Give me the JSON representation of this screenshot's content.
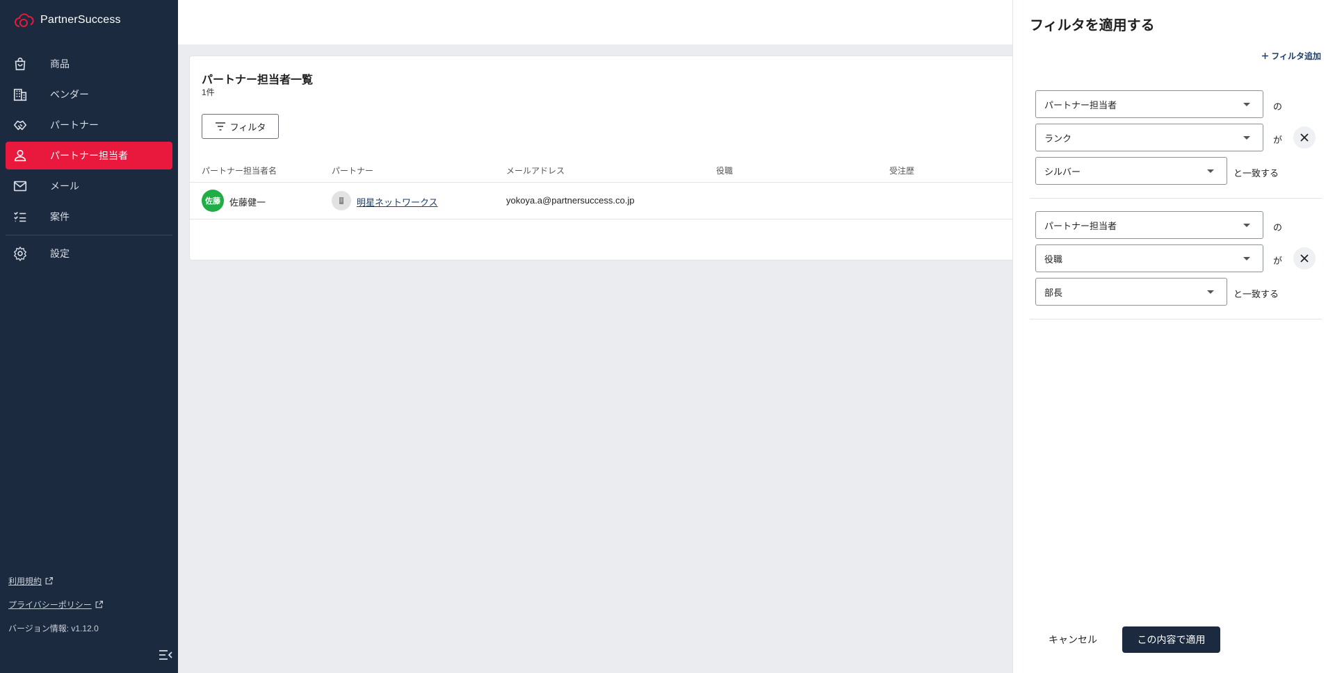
{
  "app": {
    "brand_name": "PartnerSuccess",
    "brand_color": "#e8193c",
    "sidebar_color": "#1b2a3f"
  },
  "sidebar": {
    "items": [
      {
        "label": "商品",
        "icon": "shopping-bag-icon"
      },
      {
        "label": "ベンダー",
        "icon": "building-icon"
      },
      {
        "label": "パートナー",
        "icon": "handshake-icon"
      },
      {
        "label": "パートナー担当者",
        "icon": "person-icon",
        "active": true
      },
      {
        "label": "メール",
        "icon": "mail-icon"
      },
      {
        "label": "案件",
        "icon": "checklist-icon"
      },
      {
        "label": "設定",
        "icon": "gear-icon"
      }
    ],
    "footer": {
      "terms": "利用規約",
      "privacy": "プライバシーポリシー",
      "version": "バージョン情報: v1.12.0"
    }
  },
  "list": {
    "title": "パートナー担当者一覧",
    "count": "1件",
    "filter_button": "フィルタ",
    "columns": [
      "パートナー担当者名",
      "パートナー",
      "メールアドレス",
      "役職",
      "受注歴"
    ],
    "rows": [
      {
        "avatar": "佐藤",
        "name": "佐藤健一",
        "partner": "明星ネットワークス",
        "email": "yokoya.a@partnersuccess.co.jp",
        "title": "",
        "orders": ""
      }
    ]
  },
  "filter_panel": {
    "title": "フィルタを適用する",
    "add_filter": "フィルタ追加",
    "groups": [
      {
        "object": "パートナー担当者",
        "of": "の",
        "field": "ランク",
        "ga": "が",
        "value": "シルバー",
        "match": "と一致する"
      },
      {
        "object": "パートナー担当者",
        "of": "の",
        "field": "役職",
        "ga": "が",
        "value": "部長",
        "match": "と一致する"
      }
    ],
    "cancel": "キャンセル",
    "apply": "この内容で適用"
  }
}
